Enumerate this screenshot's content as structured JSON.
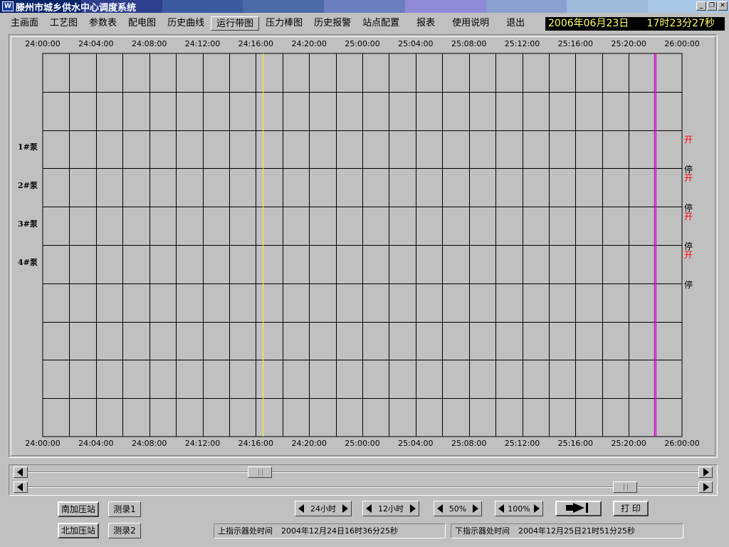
{
  "window": {
    "title": "滕州市城乡供水中心调度系统",
    "icon_text": "W",
    "title_colors": [
      "#0a246a",
      "#2e3f8e",
      "#3a5aa0",
      "#4a6aa8",
      "#6b7fc0",
      "#8f8ad8",
      "#8aa0d0",
      "#9cbadc",
      "#a8c8e8"
    ],
    "controls": [
      "minimize-icon",
      "restore-icon",
      "close-icon"
    ]
  },
  "menu": {
    "items": [
      "主画面",
      "工艺图",
      "参数表",
      "配电图",
      "历史曲线",
      "运行带图",
      "压力棒图",
      "历史报警",
      "站点配置",
      "报表",
      "使用说明",
      "退出"
    ],
    "active_index": 5
  },
  "datetime": {
    "date": "2006年06月23日",
    "time": "17时23分27秒"
  },
  "chart_data": {
    "type": "line",
    "time_ticks": [
      "24:00:00",
      "24:04:00",
      "24:08:00",
      "24:12:00",
      "24:16:00",
      "24:20:00",
      "25:00:00",
      "25:04:00",
      "25:08:00",
      "25:12:00",
      "25:16:00",
      "25:20:00",
      "26:00:00"
    ],
    "pumps": [
      {
        "name": "1#泵",
        "on_label": "开",
        "off_label": "停"
      },
      {
        "name": "2#泵",
        "on_label": "开",
        "off_label": "停"
      },
      {
        "name": "3#泵",
        "on_label": "开",
        "off_label": "停"
      },
      {
        "name": "4#泵",
        "on_label": "开",
        "off_label": "停"
      }
    ],
    "grid_columns": 24,
    "grid_rows": 10,
    "upper_indicator_fraction": 0.345,
    "lower_indicator_fraction": 0.957,
    "upper_indicator_color": "#ffff00",
    "lower_indicator_color": "#cc00cc",
    "on_color": "#ff0000",
    "grid_color": "#000000"
  },
  "scrollbars": {
    "upper_thumb_fraction": 0.34,
    "lower_thumb_fraction": 0.905
  },
  "controls": {
    "south_station": "南加压站",
    "north_station": "北加压站",
    "record1": "测录1",
    "record2": "测录2",
    "range24": "24小时",
    "range12": "12小时",
    "zoom50": "50%",
    "zoom100": "100%",
    "print": "打 印"
  },
  "status": {
    "upper_label": "上指示器处时间",
    "upper_value": "2004年12月24日16时36分25秒",
    "lower_label": "下指示器处时间",
    "lower_value": "2004年12月25日21时51分25秒"
  }
}
